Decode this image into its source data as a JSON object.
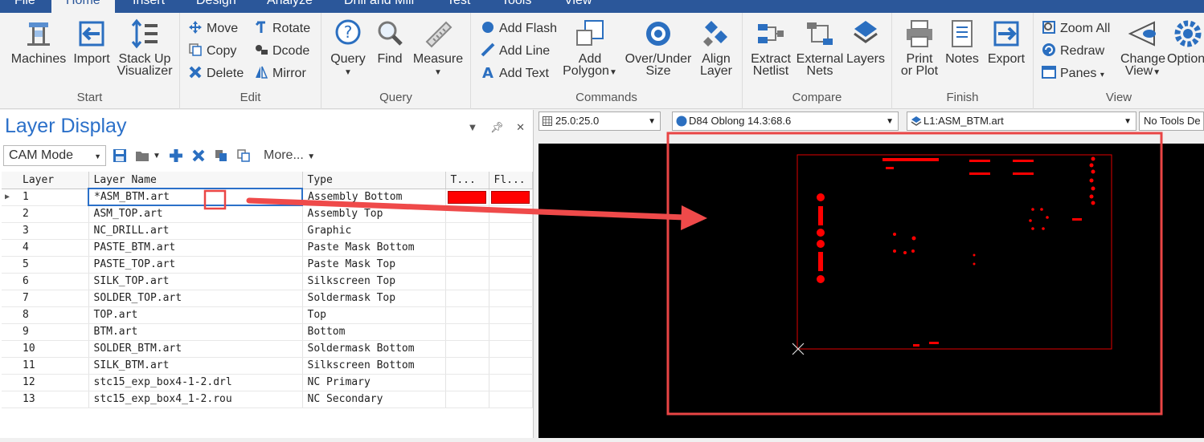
{
  "menu": {
    "tabs": [
      "File",
      "Home",
      "Insert",
      "Design",
      "Analyze",
      "Drill and Mill",
      "Test",
      "Tools",
      "View"
    ],
    "active": "Home"
  },
  "ribbon": {
    "start": {
      "label": "Start",
      "machines": "Machines",
      "import": "Import",
      "stackup_1": "Stack Up",
      "stackup_2": "Visualizer"
    },
    "edit": {
      "label": "Edit",
      "move": "Move",
      "copy": "Copy",
      "delete": "Delete",
      "rotate": "Rotate",
      "dcode": "Dcode",
      "mirror": "Mirror"
    },
    "query": {
      "label": "Query",
      "query": "Query",
      "find": "Find",
      "measure": "Measure"
    },
    "commands": {
      "label": "Commands",
      "add_flash": "Add Flash",
      "add_line": "Add Line",
      "add_text": "Add Text",
      "add_polygon_1": "Add",
      "add_polygon_2": "Polygon",
      "over_under_1": "Over/Under",
      "over_under_2": "Size",
      "align_1": "Align",
      "align_2": "Layer"
    },
    "compare": {
      "label": "Compare",
      "extract_1": "Extract",
      "extract_2": "Netlist",
      "external_1": "External",
      "external_2": "Nets",
      "layers": "Layers"
    },
    "finish": {
      "label": "Finish",
      "print_1": "Print",
      "print_2": "or Plot",
      "notes": "Notes",
      "export": "Export"
    },
    "view": {
      "label": "View",
      "zoom_all": "Zoom All",
      "redraw": "Redraw",
      "panes": "Panes",
      "change_view_1": "Change",
      "change_view_2": "View",
      "options": "Options"
    }
  },
  "panel": {
    "title": "Layer Display",
    "mode": "CAM Mode",
    "more": "More...",
    "columns": [
      "Layer",
      "Layer Name",
      "Type",
      "T...",
      "Fl..."
    ],
    "rows": [
      {
        "layer": "1",
        "name": "*ASM_BTM.art",
        "type": "Assembly Bottom",
        "t_color": "#ff0000",
        "f_color": "#ff0000"
      },
      {
        "layer": "2",
        "name": "ASM_TOP.art",
        "type": "Assembly Top"
      },
      {
        "layer": "3",
        "name": "NC_DRILL.art",
        "type": "Graphic"
      },
      {
        "layer": "4",
        "name": "PASTE_BTM.art",
        "type": "Paste Mask Bottom"
      },
      {
        "layer": "5",
        "name": "PASTE_TOP.art",
        "type": "Paste Mask Top"
      },
      {
        "layer": "6",
        "name": "SILK_TOP.art",
        "type": "Silkscreen Top"
      },
      {
        "layer": "7",
        "name": "SOLDER_TOP.art",
        "type": "Soldermask Top"
      },
      {
        "layer": "8",
        "name": "TOP.art",
        "type": "Top"
      },
      {
        "layer": "9",
        "name": "BTM.art",
        "type": "Bottom"
      },
      {
        "layer": "10",
        "name": "SOLDER_BTM.art",
        "type": "Soldermask Bottom"
      },
      {
        "layer": "11",
        "name": "SILK_BTM.art",
        "type": "Silkscreen Bottom"
      },
      {
        "layer": "12",
        "name": "stc15_exp_box4-1-2.drl",
        "type": "NC Primary"
      },
      {
        "layer": "13",
        "name": "stc15_exp_box4_1-2.rou",
        "type": "NC Secondary"
      }
    ]
  },
  "view_toolbar": {
    "grid": "25.0:25.0",
    "dcode": "D84  Oblong 14.3:68.6",
    "layer": "L1:ASM_BTM.art",
    "tools": "No Tools De"
  },
  "colors": {
    "accent": "#2b579a",
    "title_blue": "#2b70c9",
    "layer_red": "#ff0000",
    "annotation": "#e94545"
  }
}
